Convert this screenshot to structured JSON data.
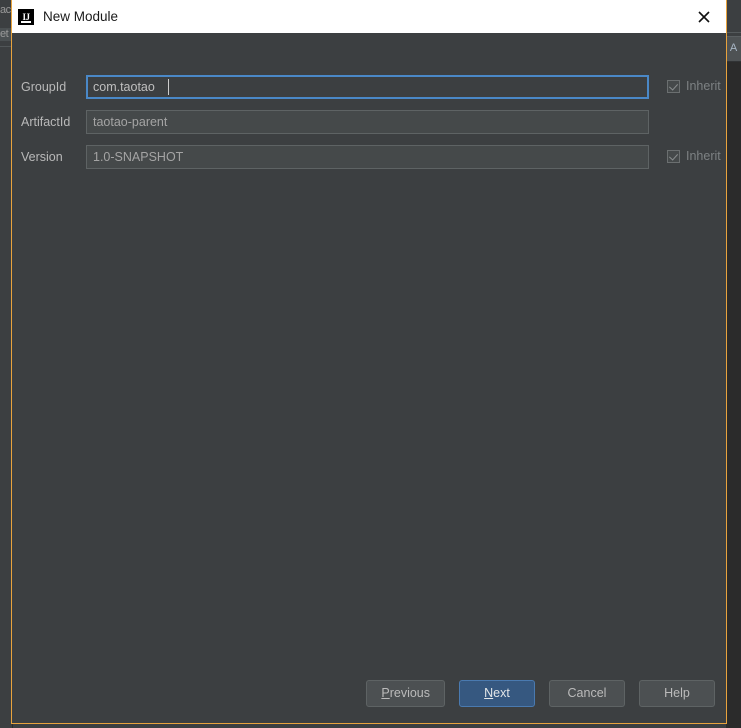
{
  "background": {
    "left_chip_1": "ac",
    "left_chip_2": "et",
    "right_tab_label": "A"
  },
  "dialog": {
    "title": "New Module",
    "app_icon_text": "IJ",
    "close_icon": "close-icon",
    "accent_border_color": "#e8a33d",
    "surface_color": "#3c3f41",
    "form": {
      "rows": [
        {
          "label": "GroupId",
          "value": "com.taotao",
          "placeholder": "",
          "focused": true,
          "inherit": {
            "label": "Inherit",
            "checked": true,
            "enabled": false
          }
        },
        {
          "label": "ArtifactId",
          "value": "taotao-parent",
          "placeholder": "",
          "focused": false,
          "inherit": null
        },
        {
          "label": "Version",
          "value": "1.0-SNAPSHOT",
          "placeholder": "",
          "focused": false,
          "inherit": {
            "label": "Inherit",
            "checked": true,
            "enabled": false
          }
        }
      ]
    },
    "buttons": [
      {
        "label": "Previous",
        "mnemonic": "P",
        "prefix": "",
        "suffix": "revious",
        "default": false
      },
      {
        "label": "Next",
        "mnemonic": "N",
        "prefix": "",
        "suffix": "ext",
        "default": true
      },
      {
        "label": "Cancel",
        "mnemonic": "",
        "prefix": "Cancel",
        "suffix": "",
        "default": false
      },
      {
        "label": "Help",
        "mnemonic": "",
        "prefix": "Help",
        "suffix": "",
        "default": false
      }
    ],
    "default_button_color": "#365880"
  }
}
